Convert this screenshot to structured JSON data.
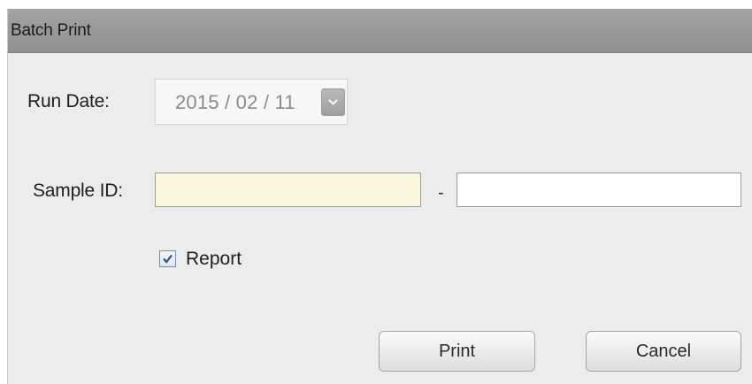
{
  "dialog": {
    "title": "Batch Print"
  },
  "run_date": {
    "label": "Run Date:",
    "value": "2015 / 02 / 11",
    "dropdown_icon": "chevron-down-icon"
  },
  "sample_id": {
    "label": "Sample ID:",
    "from_value": "",
    "separator": "-",
    "to_value": ""
  },
  "report": {
    "label": "Report",
    "checked": true,
    "check_icon": "checkmark-icon"
  },
  "buttons": {
    "print_label": "Print",
    "cancel_label": "Cancel"
  },
  "colors": {
    "title_bar": "#999999",
    "dialog_bg": "#ececec",
    "sample_from_bg": "#fbf7dc",
    "checkbox_check": "#2b4f86"
  }
}
